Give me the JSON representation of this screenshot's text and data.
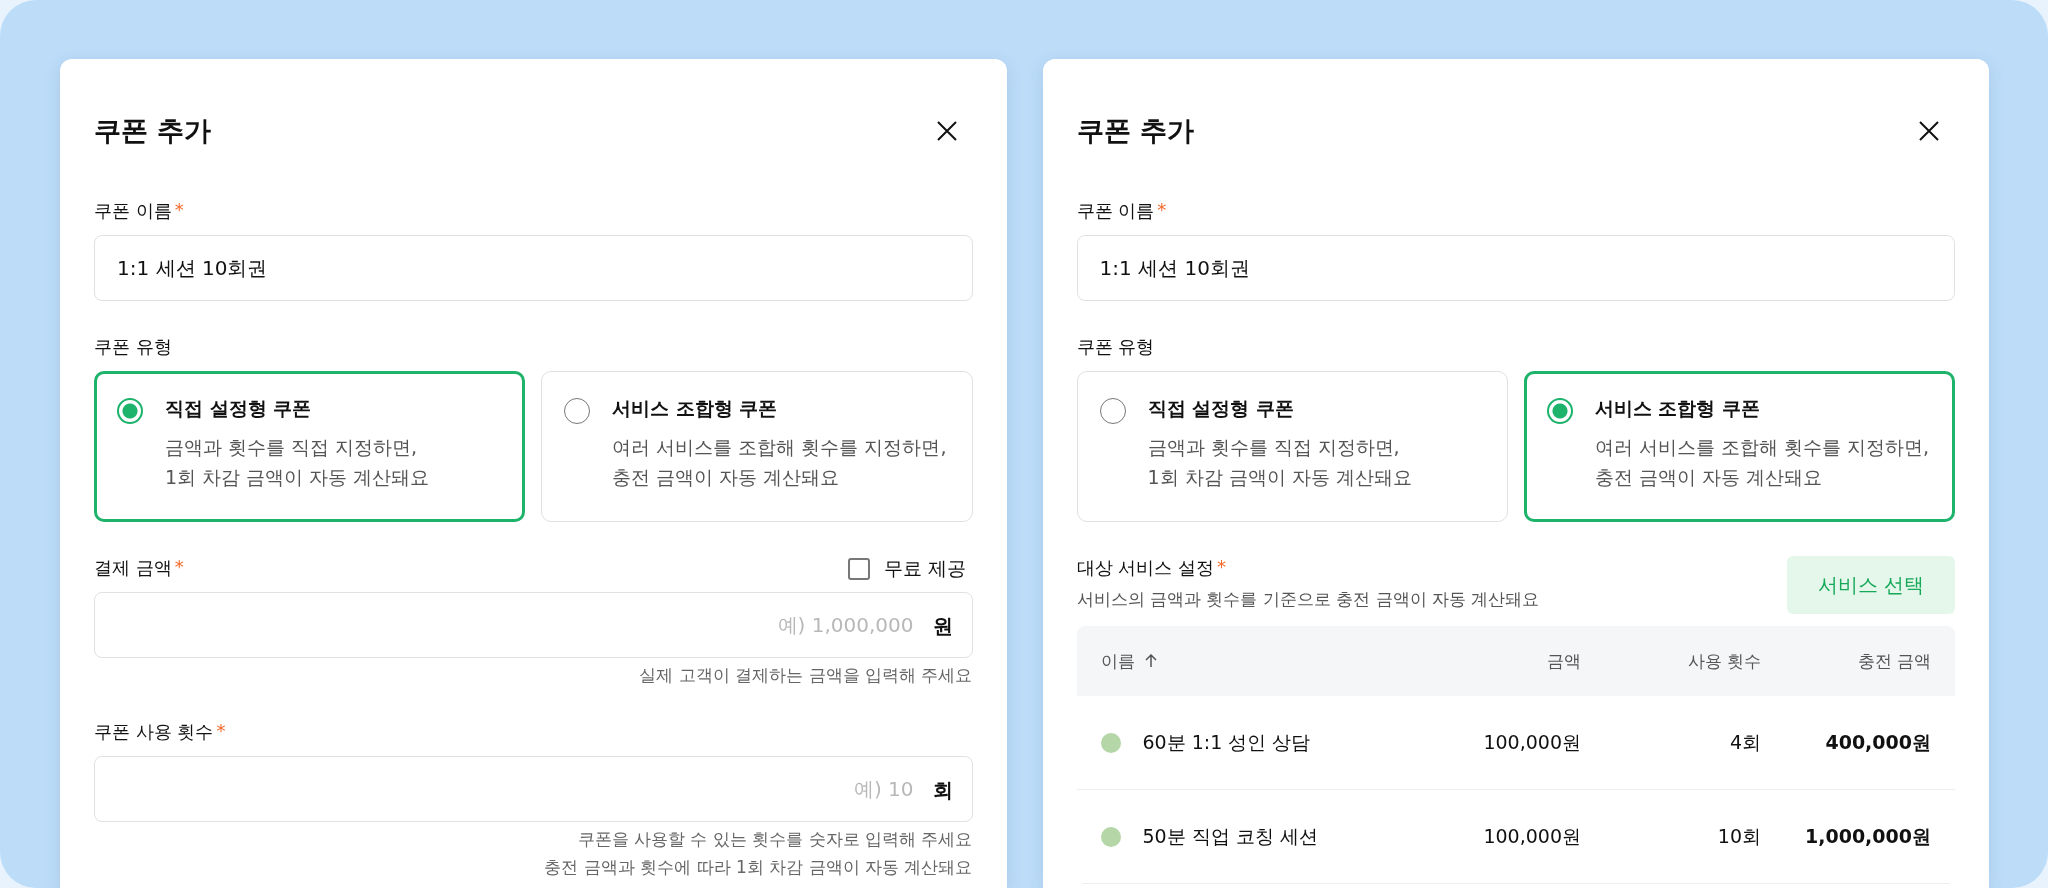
{
  "dialogs": [
    {
      "title": "쿠폰 추가",
      "sections": [
        {
          "kind": "text-input",
          "label": "쿠폰 이름",
          "required_mark": "*",
          "value": "1:1 세션 10회권"
        },
        {
          "kind": "option-cards",
          "label": "쿠폰 유형",
          "options": [
            {
              "title": "직접 설정형 쿠폰",
              "description": [
                "금액과 횟수를 직접 지정하면,",
                "1회 차감 금액이 자동 계산돼요"
              ],
              "selected": true
            },
            {
              "title": "서비스 조합형 쿠폰",
              "description": [
                "여러 서비스를 조합해 횟수를 지정하면,",
                "충전 금액이 자동 계산돼요"
              ],
              "selected": false
            }
          ]
        },
        {
          "kind": "unit-input",
          "label": "결제 금액",
          "required_mark": "*",
          "checkbox": {
            "label": "무료 제공",
            "checked": false
          },
          "placeholder": "예) 1,000,000",
          "unit": "원",
          "help": [
            "실제 고객이 결제하는 금액을 입력해 주세요"
          ]
        },
        {
          "kind": "unit-input",
          "label": "쿠폰 사용 횟수",
          "required_mark": "*",
          "placeholder": "예) 10",
          "unit": "회",
          "help": [
            "쿠폰을 사용할 수 있는 횟수를 숫자로 입력해 주세요",
            "충전 금액과 횟수에 따라 1회 차감 금액이 자동 계산돼요"
          ]
        }
      ]
    },
    {
      "title": "쿠폰 추가",
      "sections": [
        {
          "kind": "text-input",
          "label": "쿠폰 이름",
          "required_mark": "*",
          "value": "1:1 세션 10회권"
        },
        {
          "kind": "option-cards",
          "label": "쿠폰 유형",
          "options": [
            {
              "title": "직접 설정형 쿠폰",
              "description": [
                "금액과 횟수를 직접 지정하면,",
                "1회 차감 금액이 자동 계산돼요"
              ],
              "selected": false
            },
            {
              "title": "서비스 조합형 쿠폰",
              "description": [
                "여러 서비스를 조합해 횟수를 지정하면,",
                "충전 금액이 자동 계산돼요"
              ],
              "selected": true
            }
          ]
        },
        {
          "kind": "service-table",
          "label": "대상 서비스 설정",
          "required_mark": "*",
          "description": "서비스의 금액과 횟수를 기준으로 충전 금액이 자동 계산돼요",
          "button": "서비스 선택",
          "columns": [
            {
              "label": "이름",
              "sorted": true
            },
            {
              "label": "금액",
              "sorted": false
            },
            {
              "label": "사용 횟수",
              "sorted": false
            },
            {
              "label": "충전 금액",
              "sorted": false
            }
          ],
          "rows": [
            {
              "color": "#b5d6a7",
              "name": "60분 1:1 성인 상담",
              "price": "100,000원",
              "count": "4회",
              "total": "400,000원"
            },
            {
              "color": "#b5d6a7",
              "name": "50분 직업 코칭 세션",
              "price": "100,000원",
              "count": "10회",
              "total": "1,000,000원"
            }
          ]
        }
      ]
    }
  ]
}
